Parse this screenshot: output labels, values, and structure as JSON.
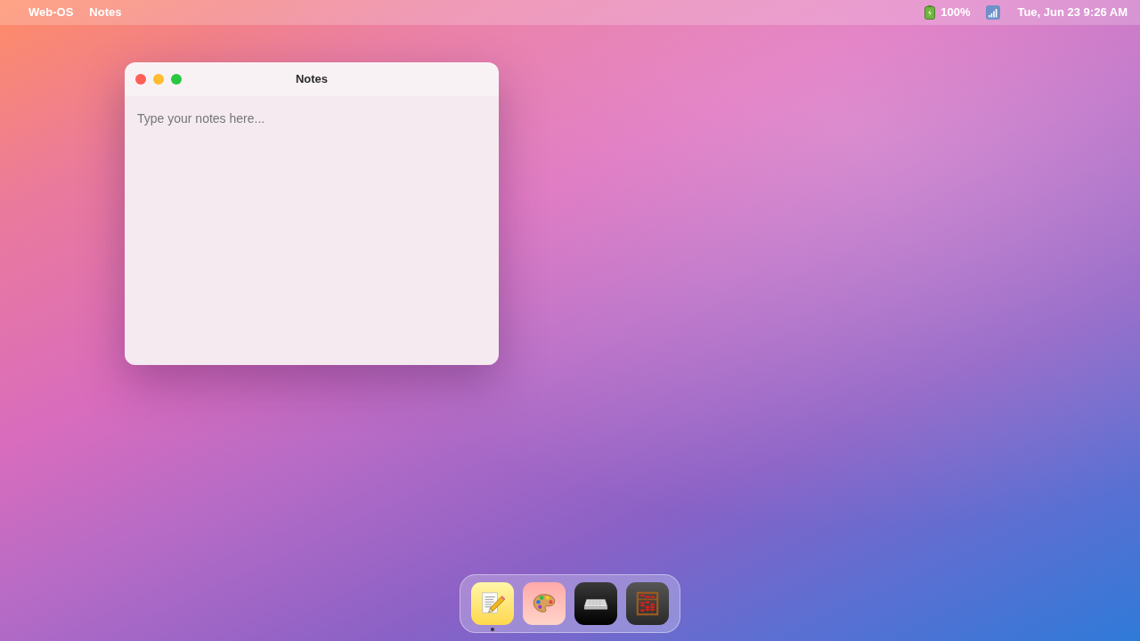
{
  "menu_bar": {
    "system_name": "Web-OS",
    "active_app": "Notes",
    "battery": "100%",
    "clock": "Tue, Jun 23 9:26 AM"
  },
  "window": {
    "title": "Notes",
    "editor": {
      "placeholder": "Type your notes here..."
    }
  },
  "dock": {
    "items": [
      {
        "kind": "notes",
        "running": true
      },
      {
        "kind": "paint",
        "running": false
      },
      {
        "kind": "terminal",
        "running": false
      },
      {
        "kind": "calculator",
        "running": false
      }
    ]
  }
}
